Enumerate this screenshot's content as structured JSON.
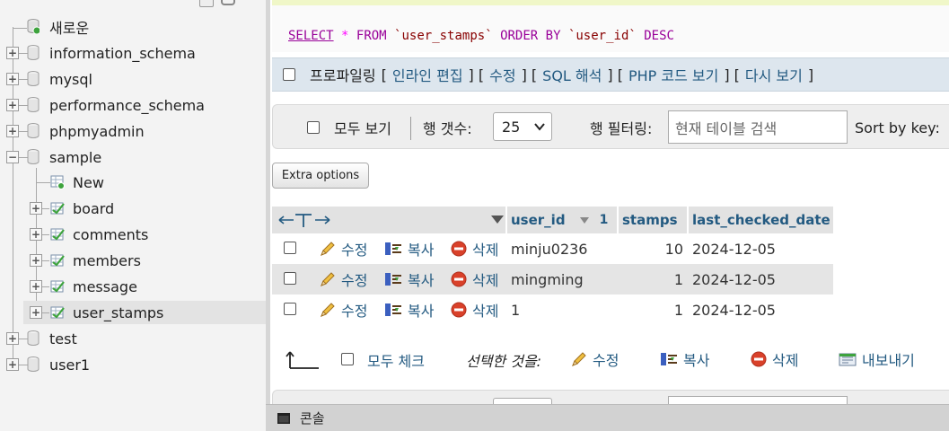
{
  "sidebar": {
    "new_label": "새로운",
    "databases": [
      {
        "name": "information_schema",
        "toggle": "+"
      },
      {
        "name": "mysql",
        "toggle": "+"
      },
      {
        "name": "performance_schema",
        "toggle": "+"
      },
      {
        "name": "phpmyadmin",
        "toggle": "+"
      },
      {
        "name": "sample",
        "toggle": "−"
      },
      {
        "name": "test",
        "toggle": "+"
      },
      {
        "name": "user1",
        "toggle": "+"
      }
    ],
    "sample_children": {
      "new_label": "New",
      "tables": [
        "board",
        "comments",
        "members",
        "message",
        "user_stamps"
      ],
      "selected": "user_stamps"
    }
  },
  "query": {
    "select": "SELECT",
    "star": "*",
    "from": "FROM",
    "table": "`user_stamps`",
    "order_by": "ORDER BY",
    "column": "`user_id`",
    "desc": "DESC"
  },
  "profiling_bar": {
    "profiling_label": "프로파일링",
    "links": [
      "인라인 편집",
      "수정",
      "SQL 해석",
      "PHP 코드 보기",
      "다시 보기"
    ]
  },
  "navigation": {
    "show_all": "모두 보기",
    "rows_label": "행 갯수:",
    "rows_value": "25",
    "filter_label": "행 필터링:",
    "filter_placeholder": "현재 테이블 검색",
    "sort_label": "Sort by key:"
  },
  "extra_options_label": "Extra options",
  "table": {
    "columns": [
      "user_id",
      "stamps",
      "last_checked_date"
    ],
    "sort_index": "1",
    "action_labels": {
      "edit": "수정",
      "copy": "복사",
      "delete": "삭제"
    },
    "rows": [
      {
        "user_id": "minju0236",
        "stamps": "10",
        "last_checked_date": "2024-12-05"
      },
      {
        "user_id": "mingming",
        "stamps": "1",
        "last_checked_date": "2024-12-05"
      },
      {
        "user_id": "1",
        "stamps": "1",
        "last_checked_date": "2024-12-05"
      }
    ]
  },
  "bulk_actions": {
    "check_all": "모두 체크",
    "with_selected": "선택한 것을:",
    "edit": "수정",
    "copy": "복사",
    "delete": "삭제",
    "export": "내보내기"
  },
  "console_label": "콘솔",
  "colors": {
    "link": "#235a81",
    "sql_keyword": "#990099",
    "sql_identifier": "#880000",
    "delete_icon": "#d9412a"
  }
}
